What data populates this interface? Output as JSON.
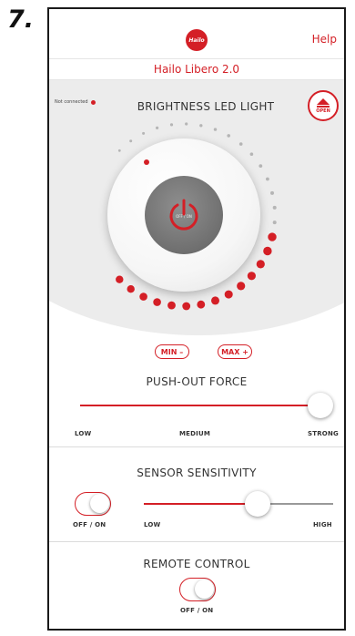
{
  "step_number": "7.",
  "header": {
    "logo_text": "Hailo",
    "help_label": "Help",
    "device_name": "Hailo Libero 2.0"
  },
  "brightness": {
    "status_text": "Not connected",
    "title": "BRIGHTNESS LED LIGHT",
    "open_label": "OPEN",
    "power_label": "OFF / ON",
    "min_label": "MIN –",
    "max_label": "MAX +",
    "level_fraction": 0.47
  },
  "pushout": {
    "title": "PUSH-OUT FORCE",
    "low_label": "LOW",
    "medium_label": "MEDIUM",
    "strong_label": "STRONG",
    "value_fraction": 1.0
  },
  "sensor": {
    "title": "SENSOR SENSITIVITY",
    "toggle_label": "OFF / ON",
    "low_label": "LOW",
    "high_label": "HIGH",
    "value_fraction": 0.6
  },
  "remote": {
    "title": "REMOTE CONTROL",
    "toggle_label": "OFF / ON"
  },
  "colors": {
    "accent": "#d41f26",
    "inactive_dot": "#b5b5b5",
    "track": "#999999"
  }
}
